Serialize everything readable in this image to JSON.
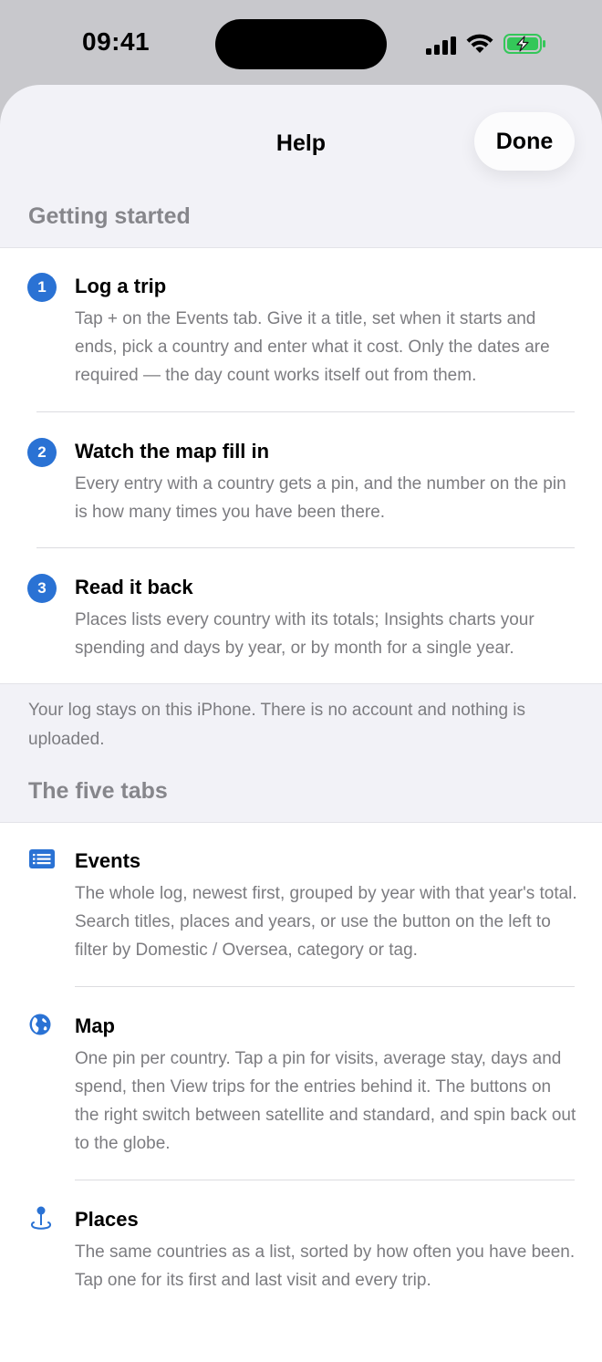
{
  "status_bar": {
    "time": "09:41"
  },
  "nav": {
    "title": "Help",
    "done_label": "Done"
  },
  "sections": {
    "getting_started": {
      "header": "Getting started",
      "items": [
        {
          "number": "1",
          "title": "Log a trip",
          "body": "Tap + on the Events tab. Give it a title, set when it starts and ends, pick a country and enter what it cost. Only the dates are required — the day count works itself out from them."
        },
        {
          "number": "2",
          "title": "Watch the map fill in",
          "body": "Every entry with a country gets a pin, and the number on the pin is how many times you have been there."
        },
        {
          "number": "3",
          "title": "Read it back",
          "body": "Places lists every country with its totals; Insights charts your spending and days by year, or by month for a single year."
        }
      ],
      "footer": "Your log stays on this iPhone. There is no account and nothing is uploaded."
    },
    "five_tabs": {
      "header": "The five tabs",
      "items": [
        {
          "icon": "list-icon",
          "title": "Events",
          "body": "The whole log, newest first, grouped by year with that year's total. Search titles, places and years, or use the button on the left to filter by Domestic / Oversea, category or tag."
        },
        {
          "icon": "globe-icon",
          "title": "Map",
          "body": "One pin per country. Tap a pin for visits, average stay, days and spend, then View trips for the entries behind it. The buttons on the right switch between satellite and standard, and spin back out to the globe."
        },
        {
          "icon": "map-pin-icon",
          "title": "Places",
          "body": "The same countries as a list, sorted by how often you have been. Tap one for its first and last visit and every trip."
        }
      ]
    }
  },
  "colors": {
    "accent": "#2a72d4",
    "sheet_bg": "#f2f2f7",
    "secondary_text": "#7c7c80",
    "battery": "#34c759"
  }
}
